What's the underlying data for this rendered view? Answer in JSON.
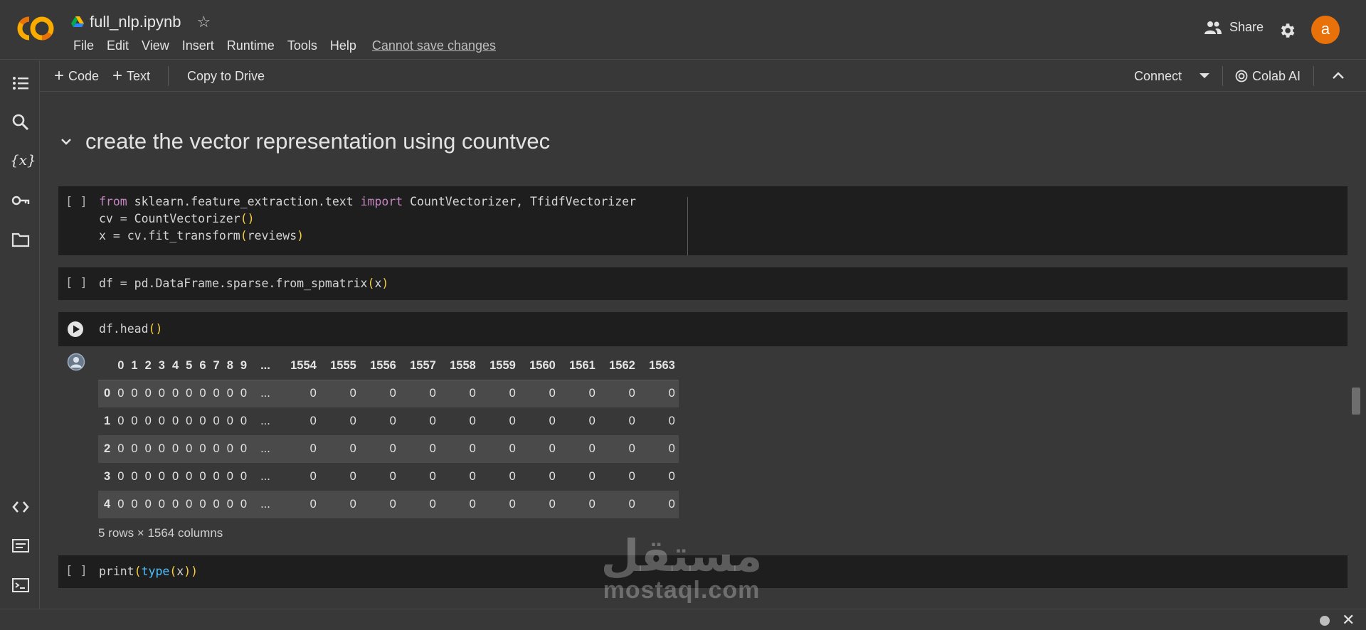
{
  "app": {
    "file_name": "full_nlp.ipynb",
    "menus": [
      "File",
      "Edit",
      "View",
      "Insert",
      "Runtime",
      "Tools",
      "Help"
    ],
    "save_warning": "Cannot save changes",
    "share_label": "Share",
    "avatar_letter": "a",
    "accent_color": "#e8710a"
  },
  "toolbar": {
    "code_label": "Code",
    "text_label": "Text",
    "copy_label": "Copy to Drive",
    "connect_label": "Connect",
    "colab_ai_label": "Colab AI"
  },
  "section": {
    "title": "create the vector representation using countvec"
  },
  "cells": {
    "bracket": "[ ]",
    "cell1_lines": [
      "from sklearn.feature_extraction.text import CountVectorizer, TfidfVectorizer",
      "cv = CountVectorizer()",
      "x = cv.fit_transform(reviews)"
    ],
    "cell2": "df = pd.DataFrame.sparse.from_spmatrix(x)",
    "cell3": "df.head()",
    "cell4": "print(type(x))"
  },
  "dataframe": {
    "columns_left": [
      "0",
      "1",
      "2",
      "3",
      "4",
      "5",
      "6",
      "7",
      "8",
      "9"
    ],
    "ellipsis": "...",
    "columns_right": [
      "1554",
      "1555",
      "1556",
      "1557",
      "1558",
      "1559",
      "1560",
      "1561",
      "1562",
      "1563"
    ],
    "index": [
      "0",
      "1",
      "2",
      "3",
      "4"
    ],
    "cell_value": "0",
    "shape_text": "5 rows × 1564 columns"
  },
  "watermark": {
    "arabic": "مستقل",
    "latin": "mostaql.com"
  }
}
